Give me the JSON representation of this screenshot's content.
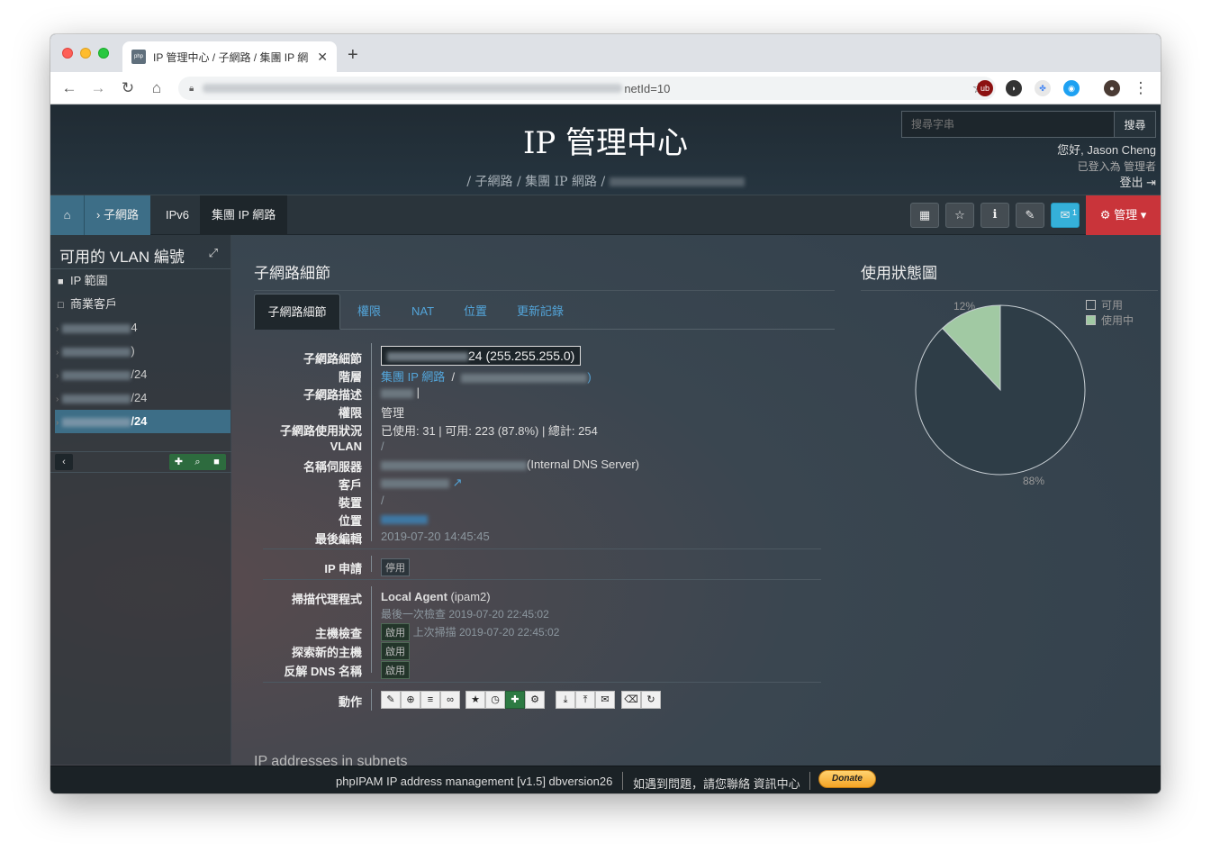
{
  "browser": {
    "tab_title": "IP 管理中心 / 子網路 / 集團 IP 網",
    "favicon_text": "php IPAM",
    "url_visible_suffix": "netId=10",
    "new_tab": "+",
    "close": "✕"
  },
  "header": {
    "title": "IP 管理中心",
    "breadcrumb": [
      "子網路",
      "集團 IP 網路"
    ],
    "search_placeholder": "搜尋字串",
    "search_button": "搜尋",
    "greeting": "您好, Jason Cheng",
    "logged_in_as": "已登入為  管理者",
    "logout": "登出"
  },
  "nav": {
    "subnets": "子網路",
    "ipv6": "IPv6",
    "folder": "集團 IP 網路",
    "mail_badge": "1",
    "admin": "管理"
  },
  "sidebar": {
    "title": "可用的 VLAN 編號",
    "folders": [
      "IP 範圍",
      "商業客戶"
    ],
    "subnets": [
      {
        "suffix": "4"
      },
      {
        "suffix": ")"
      },
      {
        "suffix": "/24"
      },
      {
        "suffix": "/24"
      },
      {
        "suffix": "/24",
        "active": true
      }
    ]
  },
  "main": {
    "section_title": "子網路細節",
    "tabs": [
      "子網路細節",
      "權限",
      "NAT",
      "位置",
      "更新記錄"
    ],
    "details": {
      "subnet_label": "子網路細節",
      "subnet_value": "24 (255.255.255.0)",
      "hierarchy_label": "階層",
      "hierarchy_link": "集團 IP 網路",
      "hierarchy_sep": "/",
      "hierarchy_paren": ")",
      "description_label": "子網路描述",
      "permission_label": "權限",
      "permission_value": "管理",
      "usage_label": "子網路使用狀況",
      "usage_value": "已使用: 31 | 可用: 223 (87.8%) | 總計: 254",
      "vlan_label": "VLAN",
      "vlan_value": "/",
      "ns_label": "名稱伺服器",
      "ns_value": "(Internal DNS Server)",
      "customer_label": "客戶",
      "device_label": "裝置",
      "device_value": "/",
      "location_label": "位置",
      "last_edit_label": "最後編輯",
      "last_edit_value": "2019-07-20 14:45:45",
      "ip_request_label": "IP 申請",
      "ip_request_value": "停用",
      "scan_agent_label": "掃描代理程式",
      "scan_agent_name": "Local Agent",
      "scan_agent_host": "(ipam2)",
      "last_check": "最後一次檢查 2019-07-20 22:45:02",
      "host_check_label": "主機檢查",
      "host_check_value": "啟用",
      "last_scan": "上次掃描 2019-07-20 22:45:02",
      "discover_label": "探索新的主機",
      "discover_value": "啟用",
      "rdns_label": "反解 DNS 名稱",
      "rdns_value": "啟用",
      "actions_label": "動作"
    },
    "subnets_heading": "IP addresses in subnets"
  },
  "usage_chart": {
    "title": "使用狀態圖",
    "legend_free": "可用",
    "legend_used": "使用中",
    "used_label": "12%",
    "free_label": "88%"
  },
  "chart_data": {
    "type": "pie",
    "title": "使用狀態圖",
    "categories": [
      "可用",
      "使用中"
    ],
    "values": [
      88,
      12
    ],
    "colors": [
      "#2e3d47",
      "#a1c9a3"
    ]
  },
  "footer": {
    "version": "phpIPAM IP address management [v1.5] dbversion26",
    "contact": "如遇到問題，請您聯絡 資訊中心",
    "donate": "Donate"
  }
}
